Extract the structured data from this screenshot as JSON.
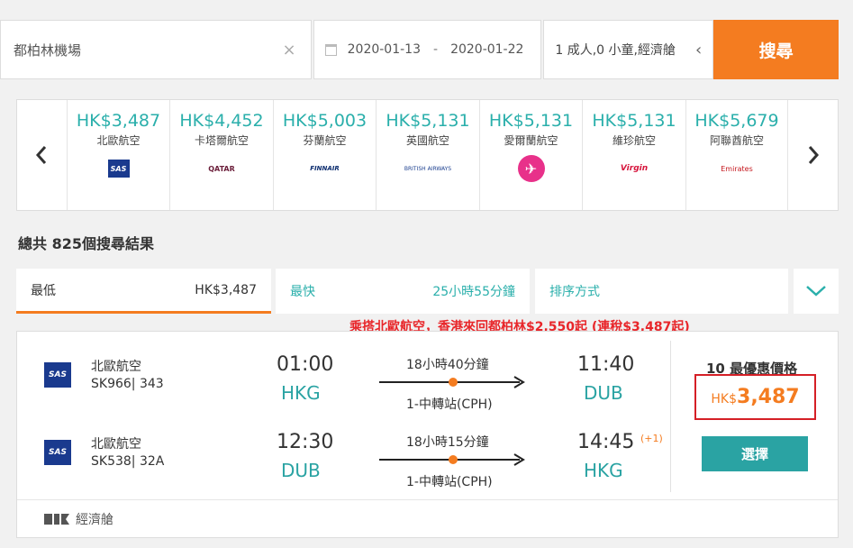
{
  "search": {
    "destination": "都柏林機場",
    "date_from": "2020-01-13",
    "date_separator": "-",
    "date_to": "2020-01-22",
    "passengers": "1 成人,0 小童,經濟艙",
    "search_label": "搜尋"
  },
  "carousel": {
    "items": [
      {
        "price": "HK$3,487",
        "airline": "北歐航空",
        "logo": "SAS"
      },
      {
        "price": "HK$4,452",
        "airline": "卡塔爾航空",
        "logo": "QATAR"
      },
      {
        "price": "HK$5,003",
        "airline": "芬蘭航空",
        "logo": "FINNAIR"
      },
      {
        "price": "HK$5,131",
        "airline": "英國航空",
        "logo": "BRITISH AIRWAYS"
      },
      {
        "price": "HK$5,131",
        "airline": "愛爾蘭航空",
        "logo": "✈"
      },
      {
        "price": "HK$5,131",
        "airline": "維珍航空",
        "logo": "Virgin"
      },
      {
        "price": "HK$5,679",
        "airline": "阿聯酋航空",
        "logo": "Emirates"
      }
    ]
  },
  "results": {
    "total": "總共 825個搜尋結果"
  },
  "sort": {
    "cheapest_label": "最低",
    "cheapest_value": "HK$3,487",
    "fastest_label": "最快",
    "fastest_value": "25小時55分鐘",
    "sort_label": "排序方式"
  },
  "promo": "乘搭北歐航空，香港來回都柏林$2,550起 (連稅$3,487起)",
  "card": {
    "outbound": {
      "airline": "北歐航空",
      "flight": "SK966| 343",
      "dep_time": "01:00",
      "dep_code": "HKG",
      "duration": "18小時40分鐘",
      "stops": "1-中轉站(CPH)",
      "arr_time": "11:40",
      "arr_code": "DUB"
    },
    "inbound": {
      "airline": "北歐航空",
      "flight": "SK538| 32A",
      "dep_time": "12:30",
      "dep_code": "DUB",
      "duration": "18小時15分鐘",
      "stops": "1-中轉站(CPH)",
      "arr_time": "14:45",
      "arr_code": "HKG",
      "day_offset": "(+1)"
    },
    "best_label": "10 最優惠價格",
    "price_currency": "HK$",
    "price_value": "3,487",
    "select_label": "選擇",
    "cabin": "經濟艙",
    "logo_text": "SAS"
  },
  "colors": {
    "accent": "#f47c20",
    "teal": "#2aafab",
    "promo_red": "#e8262a"
  }
}
